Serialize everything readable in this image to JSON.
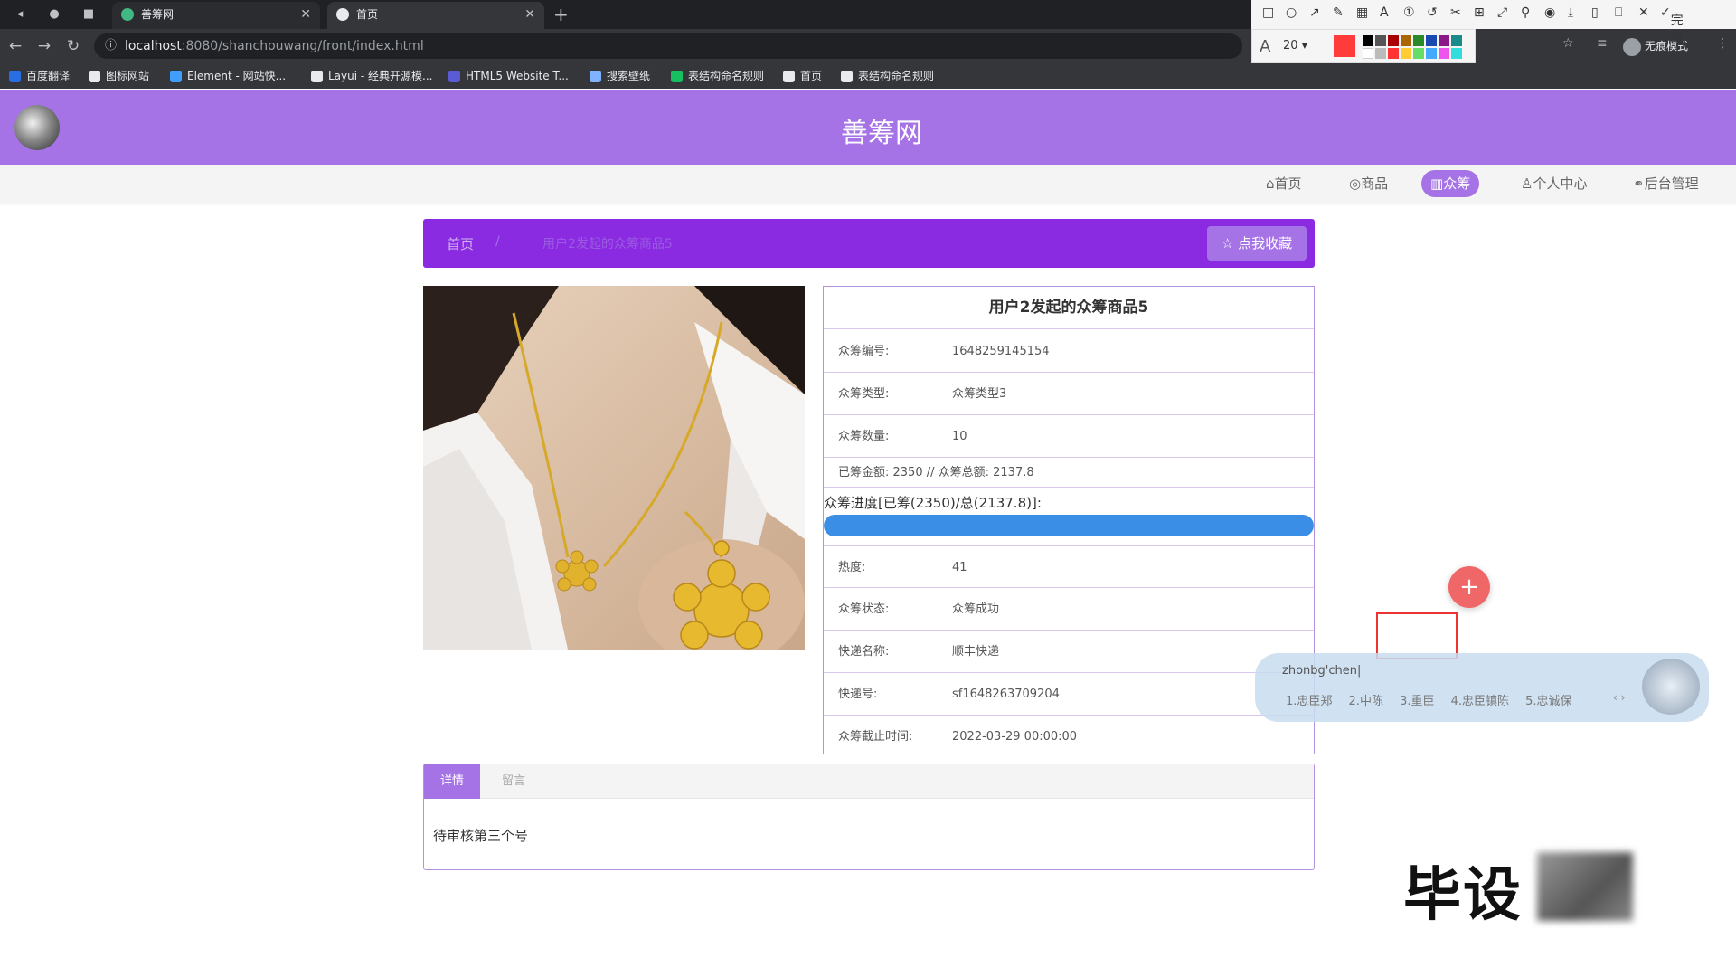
{
  "browser": {
    "tabs": [
      {
        "title": "善筹网",
        "active": false
      },
      {
        "title": "首页",
        "active": true
      }
    ],
    "url_host": "localhost",
    "url_path": ":8080/shanchouwang/front/index.html",
    "incognito_label": "无痕模式",
    "bookmarks": [
      {
        "label": "百度翻译",
        "color": "#2b6de3"
      },
      {
        "label": "图标网站",
        "color": "#e8eaed"
      },
      {
        "label": "Element - 网站快...",
        "color": "#409eff"
      },
      {
        "label": "Layui - 经典开源模...",
        "color": "#e8eaed"
      },
      {
        "label": "HTML5 Website T...",
        "color": "#5b5bd6"
      },
      {
        "label": "搜索壁纸",
        "color": "#7fb3ff"
      },
      {
        "label": "表结构命名规则",
        "color": "#16c060"
      },
      {
        "label": "首页",
        "color": "#e8eaed"
      },
      {
        "label": "表结构命名规则",
        "color": "#e8eaed"
      }
    ]
  },
  "snip_tool": {
    "finish_label": "完成",
    "font_size": "20",
    "current_color": "#ff3b3b"
  },
  "site": {
    "title": "善筹网",
    "brand_color": "#a673e6",
    "nav": [
      {
        "label": "首页",
        "icon": "home-icon",
        "active": false
      },
      {
        "label": "商品",
        "icon": "tag-icon",
        "active": false
      },
      {
        "label": "众筹",
        "icon": "grid-icon",
        "active": true
      },
      {
        "label": "个人中心",
        "icon": "user-icon",
        "active": false
      },
      {
        "label": "后台管理",
        "icon": "link-icon",
        "active": false
      }
    ]
  },
  "breadcrumb": {
    "home": "首页",
    "separator": "/",
    "current": "用户2发起的众筹商品5",
    "favorite_label": "点我收藏"
  },
  "product": {
    "title": "用户2发起的众筹商品5",
    "fields": {
      "id_label": "众筹编号:",
      "id_value": "1648259145154",
      "type_label": "众筹类型:",
      "type_value": "众筹类型3",
      "qty_label": "众筹数量:",
      "qty_value": "10",
      "amount_text": "已筹金额: 2350 // 众筹总额: 2137.8",
      "heat_label": "热度:",
      "heat_value": "41",
      "status_label": "众筹状态:",
      "status_value": "众筹成功",
      "courier_label": "快递名称:",
      "courier_value": "顺丰快递",
      "tracking_label": "快递号:",
      "tracking_value": "sf1648263709204",
      "deadline_label": "众筹截止时间:",
      "deadline_value": "2022-03-29 00:00:00"
    },
    "progress_label": "众筹进度[已筹(2350)/总(2137.8)]:",
    "progress_fraction": 1.0,
    "progress_color": "#3a8ee6"
  },
  "detail_tabs": {
    "tabs": [
      {
        "label": "详情",
        "active": true
      },
      {
        "label": "留言",
        "active": false
      }
    ],
    "content": "待审核第三个号"
  },
  "ime": {
    "pinyin": "zhonbg'chen|",
    "candidates": "1.忠臣郑 2.中陈 3.重臣 4.忠臣镇陈 5.忠诚保",
    "arrows": "‹ ›"
  },
  "watermark": {
    "text": "毕设"
  }
}
